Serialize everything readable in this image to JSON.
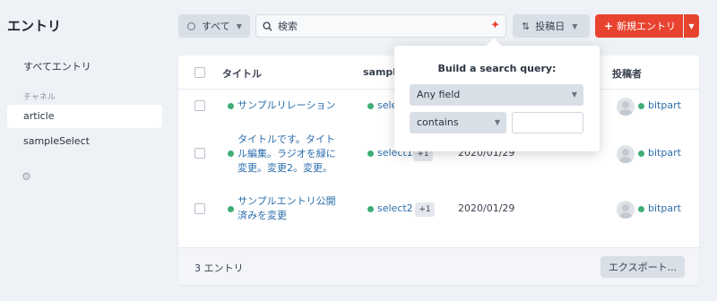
{
  "sidebar": {
    "title": "エントリ",
    "all_entries": "すべてエントリ",
    "section_label": "チャネル",
    "channels": [
      "article",
      "sampleSelect"
    ],
    "settings_icon": "gear-icon"
  },
  "toolbar": {
    "status_filter": "すべて",
    "search_placeholder": "検索",
    "sort_label": "投稿日",
    "new_entry_label": "新規エントリ"
  },
  "table": {
    "columns": {
      "title": "タイトル",
      "sample": "sample",
      "author": "投稿者"
    },
    "rows": [
      {
        "title": "サンプルリレーション",
        "select": "select",
        "badge": "",
        "date": "",
        "author": "bitpart"
      },
      {
        "title": "タイトルです。タイトル編集。ラジオを緑に変更。変更2。変更。",
        "title_lines": [
          "タイトルです。タイト",
          "ル編集。ラジオを緑に",
          "変更。変更2。変更。"
        ],
        "select": "select1",
        "badge": "+1",
        "date": "2020/01/29",
        "author": "bitpart"
      },
      {
        "title": "サンプルエントリ公開済みを変更",
        "title_lines": [
          "サンプルエントリ公開",
          "済みを変更"
        ],
        "select": "select2",
        "badge": "+1",
        "date": "2020/01/29",
        "author": "bitpart"
      }
    ]
  },
  "footer": {
    "count": "3 エントリ",
    "export_label": "エクスポート..."
  },
  "popover": {
    "title": "Build a search query:",
    "field_value": "Any field",
    "operator_value": "contains",
    "value_input": ""
  },
  "colors": {
    "accent": "#e8432f",
    "link": "#2a6dab",
    "status_green": "#3fae76"
  }
}
